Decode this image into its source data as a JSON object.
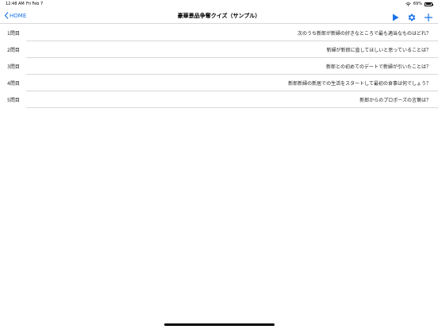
{
  "status_bar": {
    "time": "12:48 AM",
    "date": "Fri Feb 7",
    "battery": "69%",
    "battery_level": 0.69
  },
  "nav": {
    "back_label": "HOME",
    "title": "豪華景品争奪クイズ（サンプル）",
    "accent_color": "#1a73e8",
    "actions": [
      "play-icon",
      "gear-icon",
      "plus-icon"
    ]
  },
  "questions": [
    {
      "number": "1問目",
      "text": "次のうち新郎が新婦の好きなところで最も適当なものはどれ？"
    },
    {
      "number": "2問目",
      "text": "新婦が新郎に直してほしいと思っていることは？"
    },
    {
      "number": "3問目",
      "text": "新郎との初めてのデートで新婦が引いたことは？"
    },
    {
      "number": "4問目",
      "text": "新郎新婦の新居での生活をスタートして最初の食事は何でしょう？"
    },
    {
      "number": "5問目",
      "text": "新郎からのプロポーズの言葉は？"
    }
  ]
}
